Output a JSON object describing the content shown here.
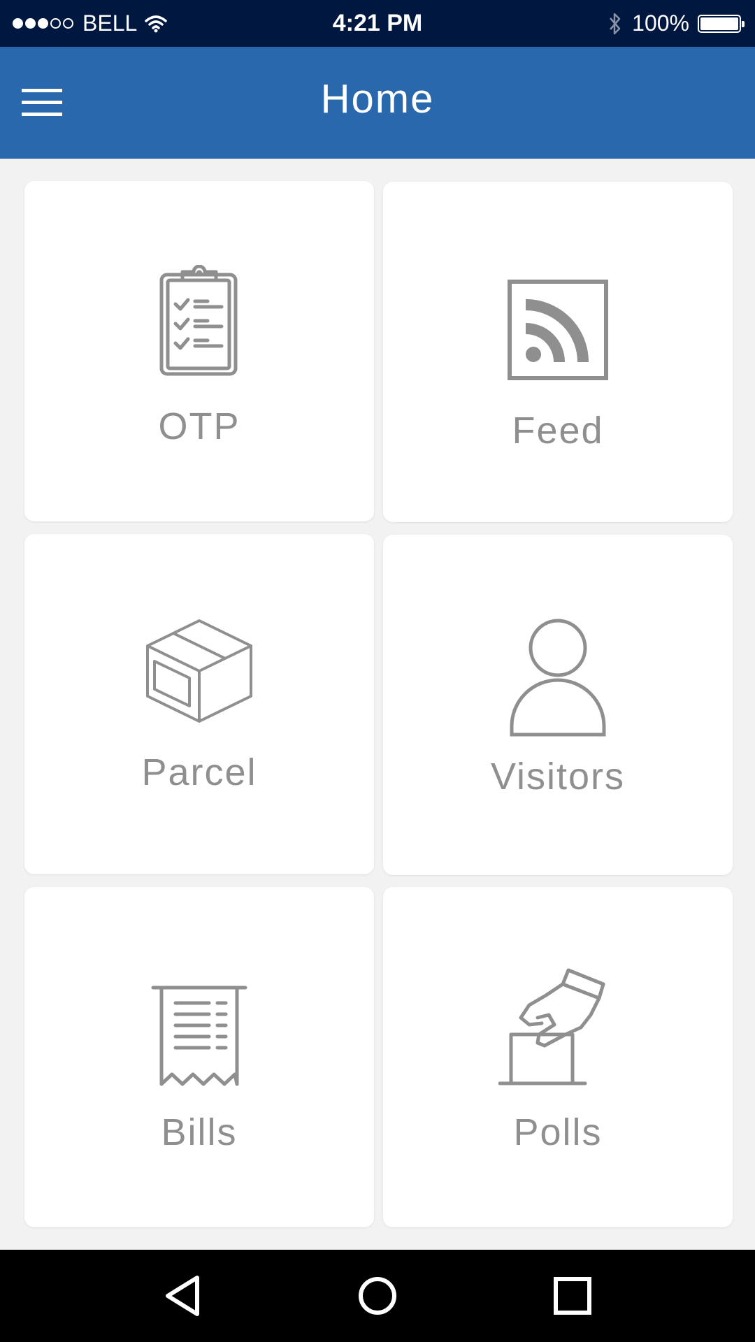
{
  "status_bar": {
    "carrier": "BELL",
    "time": "4:21 PM",
    "battery": "100%",
    "battery_level": 1.0,
    "signal_strength": 3,
    "signal_max": 5
  },
  "app_bar": {
    "title": "Home"
  },
  "tiles": [
    {
      "label": "OTP",
      "icon": "clipboard-checklist-icon"
    },
    {
      "label": "Feed",
      "icon": "rss-feed-icon"
    },
    {
      "label": "Parcel",
      "icon": "parcel-box-icon"
    },
    {
      "label": "Visitors",
      "icon": "person-icon"
    },
    {
      "label": "Bills",
      "icon": "receipt-icon"
    },
    {
      "label": "Polls",
      "icon": "ballot-box-vote-icon"
    }
  ],
  "colors": {
    "status_bar_bg": "#00173f",
    "app_bar_bg": "#2a68ae",
    "icon_gray": "#8f8f8f",
    "page_bg": "#f2f2f2"
  }
}
